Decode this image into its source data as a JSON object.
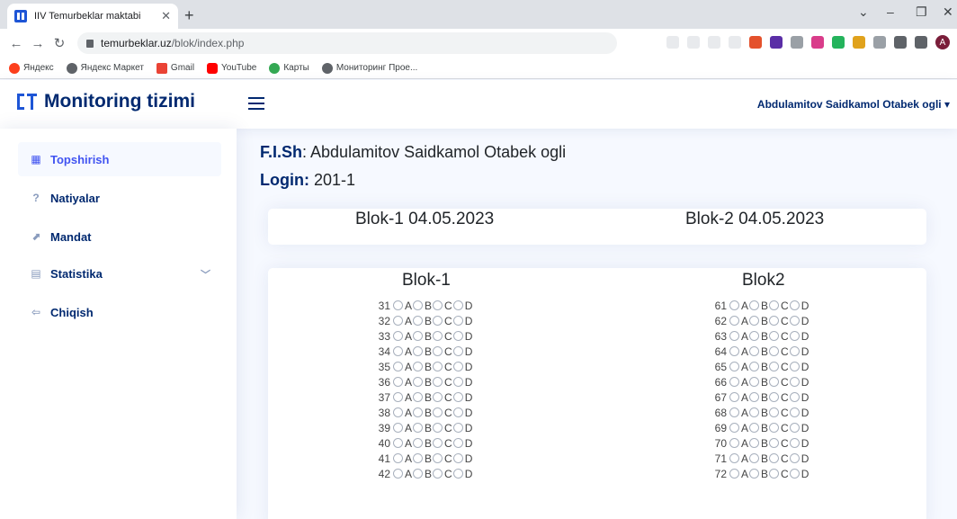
{
  "browser": {
    "tab_title": "IIV Temurbeklar maktabi",
    "url_host": "temurbeklar.uz",
    "url_path": "/blok/index.php",
    "bookmarks": [
      "Яндекс",
      "Яндекс Маркет",
      "Gmail",
      "YouTube",
      "Карты",
      "Мониторинг Прое..."
    ],
    "profile_initial": "A"
  },
  "header": {
    "brand": "Monitoring tizimi",
    "user_name": "Abdulamitov Saidkamol Otabek ogli"
  },
  "sidebar": {
    "items": [
      {
        "label": "Topshirish",
        "icon": "grid-icon",
        "active": true
      },
      {
        "label": "Natiyalar",
        "icon": "question-circle-icon",
        "active": false
      },
      {
        "label": "Mandat",
        "icon": "trend-icon",
        "active": false
      },
      {
        "label": "Statistika",
        "icon": "table-icon",
        "active": false,
        "has_chevron": true
      },
      {
        "label": "Chiqish",
        "icon": "logout-icon",
        "active": false
      }
    ]
  },
  "main": {
    "fish_label": "F.I.Sh",
    "fish_value": "Abdulamitov Saidkamol Otabek ogli",
    "login_label": "Login:",
    "login_value": "201-1",
    "blocks": [
      "Blok-1 04.05.2023",
      "Blok-2 04.05.2023"
    ],
    "columns": [
      {
        "title": "Blok-1",
        "questions": [
          31,
          32,
          33,
          34,
          35,
          36,
          37,
          38,
          39,
          40,
          41,
          42
        ]
      },
      {
        "title": "Blok2",
        "questions": [
          61,
          62,
          63,
          64,
          65,
          66,
          67,
          68,
          69,
          70,
          71,
          72
        ]
      }
    ],
    "options": [
      "A",
      "B",
      "C",
      "D"
    ]
  },
  "colors": {
    "brand_blue": "#012970",
    "accent": "#4154f1",
    "logo_blue": "#1e55d6",
    "page_bg": "#f6f9ff"
  }
}
